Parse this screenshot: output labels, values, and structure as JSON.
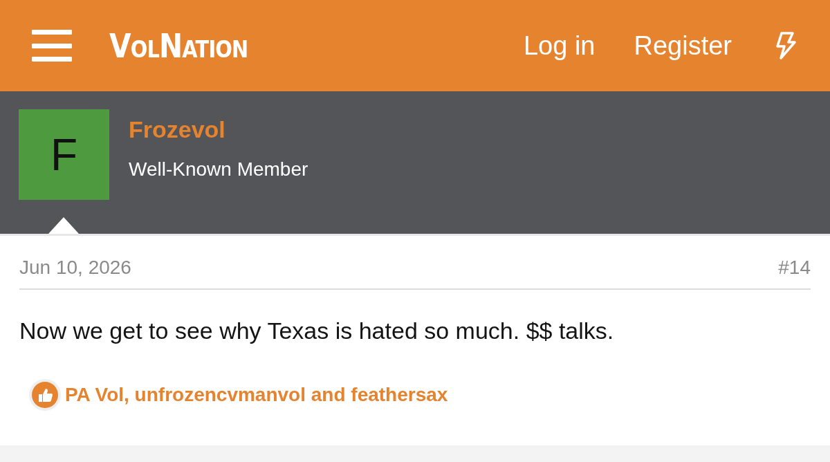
{
  "header": {
    "logo": "VolNation",
    "links": [
      "Log in",
      "Register"
    ]
  },
  "author": {
    "avatar_letter": "F",
    "name": "Frozevol",
    "title": "Well-Known Member"
  },
  "post": {
    "date": "Jun 10, 2026",
    "number": "#14",
    "body": "Now we get to see why Texas is hated so much. $$ talks.",
    "reactions": "PA Vol, unfrozencvmanvol and feathersax"
  }
}
